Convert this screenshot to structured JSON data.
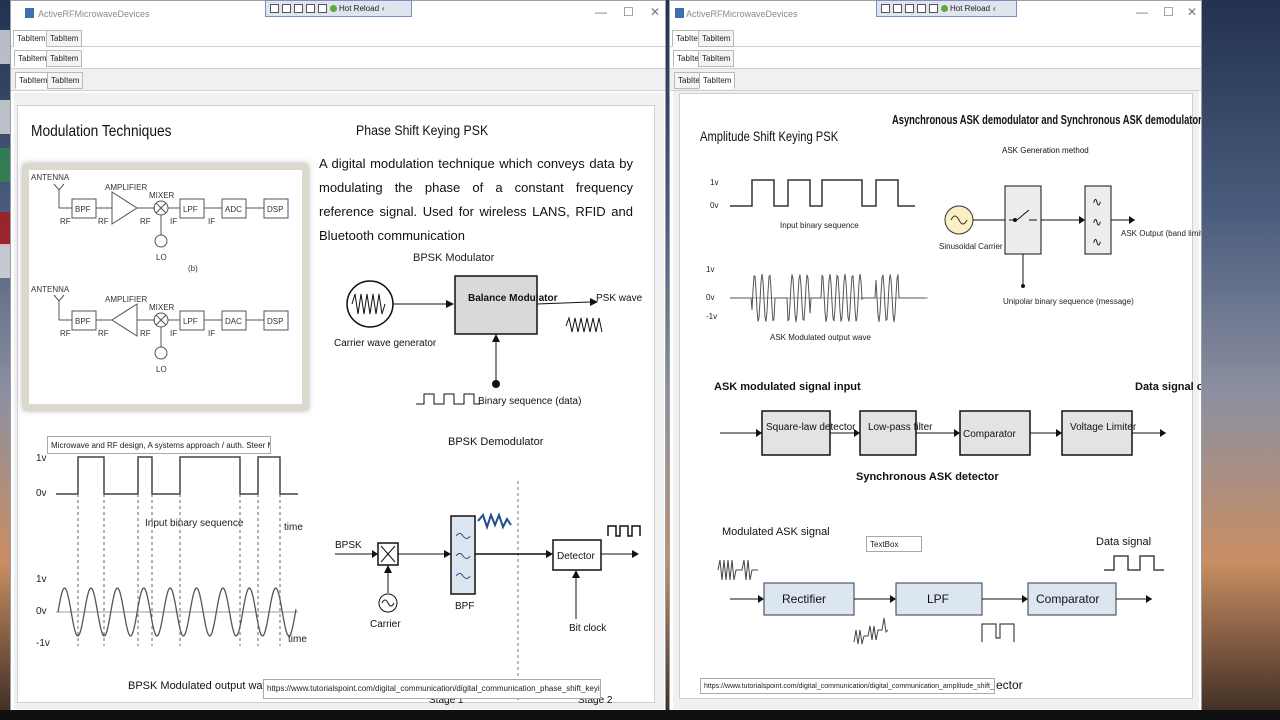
{
  "app": {
    "title": "ActiveRFMicrowaveDevices"
  },
  "devbar": {
    "hot_reload": "Hot Reload"
  },
  "tabs": {
    "tab_label": "TabItem"
  },
  "left": {
    "heading": "Modulation Techniques",
    "psk_title": "Phase Shift Keying PSK",
    "paragraph": "A digital modulation technique which conveys data by modulating the phase of a constant frequency reference signal. Used for wireless LANS, RFID and Bluetooth communication",
    "rf_chain": {
      "labels": {
        "antenna": "ANTENNA",
        "amplifier": "AMPLIFIER",
        "mixer": "MIXER",
        "rf": "RF",
        "if": "IF",
        "lo": "LO",
        "b": "(b)"
      },
      "top_blocks": [
        "BPF",
        "LPF",
        "ADC",
        "DSP"
      ],
      "bottom_blocks": [
        "BPF",
        "LPF",
        "DAC",
        "DSP"
      ]
    },
    "citation": "Microwave and RF design, A systems approach / auth. Steer Michael.",
    "waveform": {
      "input_label": "Input binary sequence",
      "output_label": "BPSK Modulated output wave",
      "time_label": "time",
      "y_high": "1v",
      "y_zero": "0v",
      "y_low": "-1v"
    },
    "bpsk_mod": {
      "title": "BPSK Modulator",
      "block": "Balance Modulator",
      "carrier": "Carrier wave generator",
      "psk_wave": "PSK wave",
      "binary": "Binary sequence (data)"
    },
    "bpsk_demod": {
      "title": "BPSK Demodulator",
      "input": "BPSK",
      "carrier": "Carrier",
      "bpf": "BPF",
      "detector": "Detector",
      "bit_clock": "Bit clock",
      "stage1": "Stage 1",
      "stage2": "Stage 2"
    },
    "url": "https://www.tutorialspoint.com/digital_communication/digital_communication_phase_shift_keying.htm"
  },
  "right": {
    "ask_title": "Amplitude Shift Keying PSK",
    "heading": "Asynchronous ASK demodulator and Synchronous ASK demodulator",
    "gen_title": "ASK Generation method",
    "wave": {
      "y_high": "1v",
      "y_zero": "0v",
      "y_low": "-1v",
      "input_label": "Input binary sequence",
      "output_label": "ASK Modulated output wave"
    },
    "gen": {
      "carrier": "Sinusoidal Carrier",
      "unipolar": "Unipolar binary sequence (message)",
      "output": "ASK Output (band limited)"
    },
    "async": {
      "input_label": "ASK modulated signal input",
      "blocks": [
        "Square-law detector",
        "Low-pass filter",
        "Comparator",
        "Voltage Limiter"
      ],
      "output_label": "Data signal output"
    },
    "sync": {
      "title": "Synchronous ASK detector",
      "input_label": "Modulated ASK signal",
      "blocks": [
        "Rectifier",
        "LPF",
        "Comparator"
      ],
      "output_label": "Data signal"
    },
    "textbox": "TextBox",
    "url": "https://www.tutorialspoint.com/digital_communication/digital_communication_amplitude_shift_keying.htm",
    "url_tail": "ector"
  },
  "colors": {
    "accent": "#3f6fb0",
    "window_bg": "#ffffff",
    "panel_bg": "#f0f0f0",
    "block_fill": "#d9d9d9",
    "sync_block": "#dce6f1"
  },
  "icons": [
    "app-icon",
    "minimize-icon",
    "maximize-icon",
    "close-icon",
    "hot-reload-icon",
    "chevron-left-icon"
  ]
}
